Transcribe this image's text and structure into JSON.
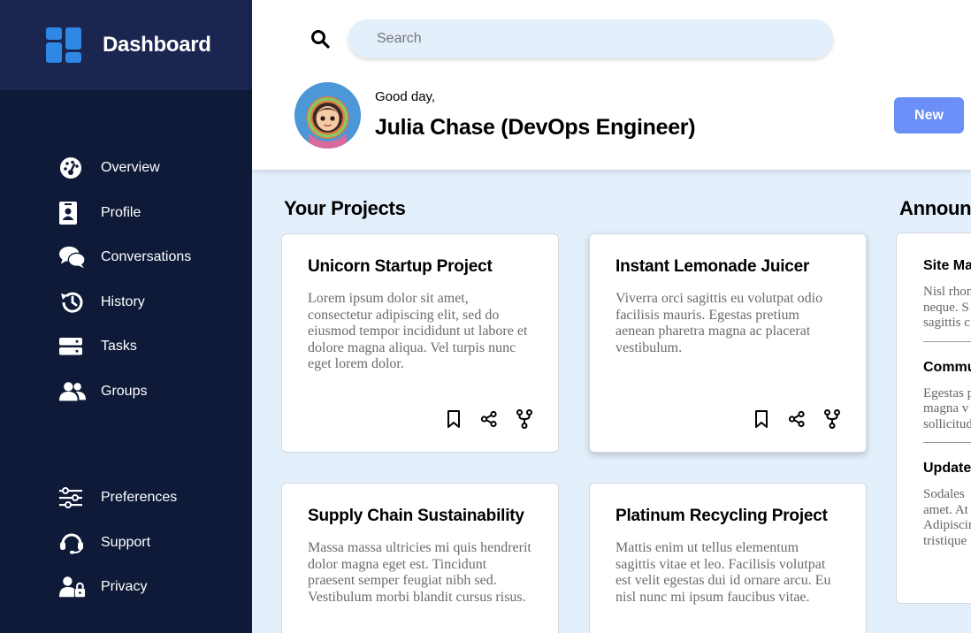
{
  "brand": {
    "title": "Dashboard",
    "color": "#2f87e6"
  },
  "sidebar": {
    "main_items": [
      {
        "label": "Overview",
        "icon": "gauge-icon"
      },
      {
        "label": "Profile",
        "icon": "id-badge-icon"
      },
      {
        "label": "Conversations",
        "icon": "chat-bubbles-icon"
      },
      {
        "label": "History",
        "icon": "history-icon"
      },
      {
        "label": "Tasks",
        "icon": "tasks-icon"
      },
      {
        "label": "Groups",
        "icon": "users-icon"
      }
    ],
    "bottom_items": [
      {
        "label": "Preferences",
        "icon": "sliders-icon"
      },
      {
        "label": "Support",
        "icon": "headset-icon"
      },
      {
        "label": "Privacy",
        "icon": "user-lock-icon"
      }
    ]
  },
  "header": {
    "search_placeholder": "Search",
    "greeting": "Good day,",
    "user_name": "Julia Chase (DevOps Engineer)",
    "new_button": "New"
  },
  "projects": {
    "title": "Your Projects",
    "items": [
      {
        "title": "Unicorn Startup Project",
        "body": "Lorem ipsum dolor sit amet, consectetur adipiscing elit, sed do eiusmod tempor incididunt ut labore et dolore magna aliqua. Vel turpis nunc eget lorem dolor."
      },
      {
        "title": "Instant Lemonade Juicer",
        "body": "Viverra orci sagittis eu volutpat odio facilisis mauris. Egestas pretium aenean pharetra magna ac placerat vestibulum."
      },
      {
        "title": "Supply Chain Sustainability",
        "body": "Massa massa ultricies mi quis hendrerit dolor magna eget est. Tincidunt praesent semper feugiat nibh sed. Vestibulum morbi blandit cursus risus."
      },
      {
        "title": "Platinum Recycling Project",
        "body": "Mattis enim ut tellus elementum sagittis vitae et leo. Facilisis volutpat est velit egestas dui id ornare arcu. Eu nisl nunc mi ipsum faucibus vitae."
      }
    ]
  },
  "announcements": {
    "title": "Announce",
    "items": [
      {
        "title": "Site Ma",
        "lines": [
          "Nisl rhon",
          "neque. S",
          "sagittis c"
        ]
      },
      {
        "title": "Commu",
        "lines": [
          "Egestas p",
          "magna v",
          "sollicitud"
        ]
      },
      {
        "title": "Updated",
        "lines": [
          "Sodales",
          "amet. At",
          "Adipiscin",
          "tristique"
        ]
      }
    ]
  },
  "colors": {
    "sidebar_bg": "#0e1a38",
    "brand_bg": "#1a2550",
    "accent": "#6b8ef7",
    "content_bg": "#e3effb"
  }
}
